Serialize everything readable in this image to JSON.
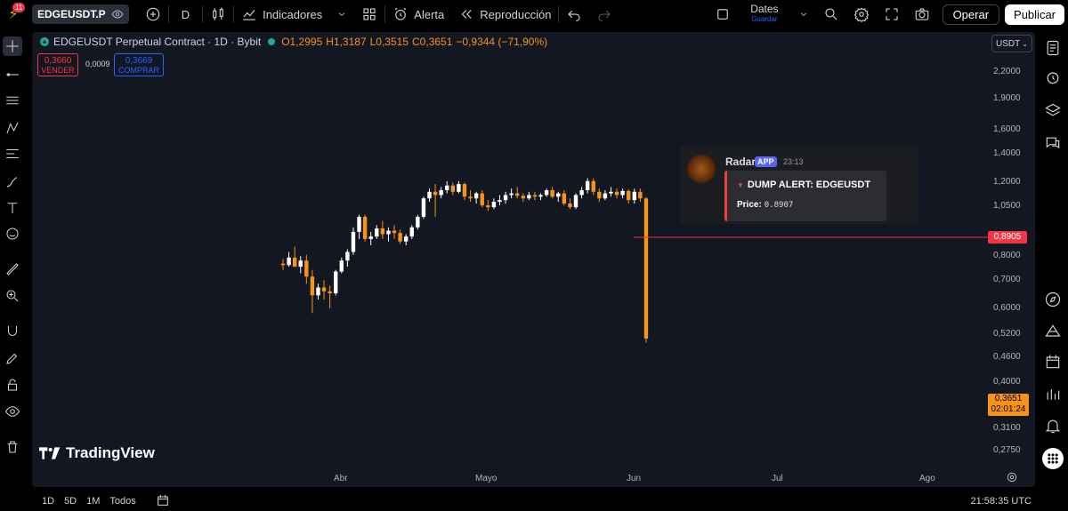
{
  "topbar": {
    "notification_count": "11",
    "symbol": "EDGEUSDT.P",
    "interval": "D",
    "indicators_label": "Indicadores",
    "alert_label": "Alerta",
    "replay_label": "Reproducción",
    "layout_name": "Dates",
    "layout_save": "Guardar",
    "trade_label": "Operar",
    "publish_label": "Publicar"
  },
  "legend": {
    "title": "EDGEUSDT Perpetual Contract · 1D · Bybit",
    "open": "O1,2995",
    "high": "H1,3187",
    "low": "L0,3515",
    "close": "C0,3651",
    "change": "−0,9344 (−71,90%)"
  },
  "trade": {
    "sell_price": "0,3660",
    "sell_label": "VENDER",
    "spread": "0,0009",
    "buy_price": "0,3669",
    "buy_label": "COMPRAR"
  },
  "currency": "USDT",
  "price_axis": [
    "2,2000",
    "1,9000",
    "1,6000",
    "1,4000",
    "1,2000",
    "1,0500",
    "0,8000",
    "0,7000",
    "0,6000",
    "0,5200",
    "0,4600",
    "0,4000",
    "0,3100",
    "0,2750"
  ],
  "alert_price": "0,8905",
  "last_price": "0,3651",
  "countdown": "02:01:24",
  "time_axis": [
    "Abr",
    "Mayo",
    "Jun",
    "Jul",
    "Ago"
  ],
  "brand": "TradingView",
  "notification": {
    "name": "Radar",
    "badge": "APP",
    "time": "23:13",
    "title": "DUMP ALERT: EDGEUSDT",
    "price_label": "Price:",
    "price_value": "0.8907"
  },
  "bottombar": {
    "ranges": [
      "1D",
      "5D",
      "1M",
      "Todos"
    ],
    "clock": "21:58:35 UTC"
  },
  "colors": {
    "up": "#ffffff",
    "down": "#f7931a",
    "alert": "#f23645",
    "background": "#131722"
  },
  "chart_data": {
    "type": "candlestick",
    "scale": "log",
    "x_ticks": [
      "Abr",
      "Mayo",
      "Jun",
      "Jul",
      "Ago"
    ],
    "ylim": [
      0.26,
      2.4
    ],
    "series": [
      {
        "candles": [
          {
            "o": 0.72,
            "h": 0.75,
            "l": 0.68,
            "c": 0.71
          },
          {
            "o": 0.71,
            "h": 0.8,
            "l": 0.7,
            "c": 0.76
          },
          {
            "o": 0.76,
            "h": 0.84,
            "l": 0.7,
            "c": 0.7
          },
          {
            "o": 0.7,
            "h": 0.77,
            "l": 0.66,
            "c": 0.74
          },
          {
            "o": 0.74,
            "h": 0.78,
            "l": 0.6,
            "c": 0.64
          },
          {
            "o": 0.64,
            "h": 0.68,
            "l": 0.46,
            "c": 0.54
          },
          {
            "o": 0.54,
            "h": 0.6,
            "l": 0.52,
            "c": 0.58
          },
          {
            "o": 0.58,
            "h": 0.62,
            "l": 0.52,
            "c": 0.56
          },
          {
            "o": 0.56,
            "h": 0.59,
            "l": 0.48,
            "c": 0.55
          },
          {
            "o": 0.55,
            "h": 0.68,
            "l": 0.54,
            "c": 0.67
          },
          {
            "o": 0.67,
            "h": 0.76,
            "l": 0.66,
            "c": 0.74
          },
          {
            "o": 0.74,
            "h": 0.82,
            "l": 0.7,
            "c": 0.8
          },
          {
            "o": 0.8,
            "h": 1.0,
            "l": 0.78,
            "c": 0.96
          },
          {
            "o": 0.96,
            "h": 1.12,
            "l": 0.9,
            "c": 1.1
          },
          {
            "o": 1.1,
            "h": 1.12,
            "l": 0.88,
            "c": 0.9
          },
          {
            "o": 0.9,
            "h": 0.96,
            "l": 0.85,
            "c": 0.92
          },
          {
            "o": 0.92,
            "h": 1.02,
            "l": 0.9,
            "c": 0.99
          },
          {
            "o": 0.99,
            "h": 1.06,
            "l": 0.9,
            "c": 0.94
          },
          {
            "o": 0.94,
            "h": 1.0,
            "l": 0.88,
            "c": 0.97
          },
          {
            "o": 0.97,
            "h": 1.02,
            "l": 0.9,
            "c": 0.95
          },
          {
            "o": 0.95,
            "h": 0.98,
            "l": 0.86,
            "c": 0.88
          },
          {
            "o": 0.88,
            "h": 0.94,
            "l": 0.85,
            "c": 0.92
          },
          {
            "o": 0.92,
            "h": 1.02,
            "l": 0.9,
            "c": 1.0
          },
          {
            "o": 1.0,
            "h": 1.12,
            "l": 0.98,
            "c": 1.1
          },
          {
            "o": 1.1,
            "h": 1.32,
            "l": 1.08,
            "c": 1.3
          },
          {
            "o": 1.3,
            "h": 1.42,
            "l": 1.26,
            "c": 1.38
          },
          {
            "o": 1.38,
            "h": 1.48,
            "l": 1.1,
            "c": 1.34
          },
          {
            "o": 1.34,
            "h": 1.44,
            "l": 1.3,
            "c": 1.4
          },
          {
            "o": 1.4,
            "h": 1.52,
            "l": 1.36,
            "c": 1.46
          },
          {
            "o": 1.46,
            "h": 1.5,
            "l": 1.34,
            "c": 1.38
          },
          {
            "o": 1.38,
            "h": 1.52,
            "l": 1.36,
            "c": 1.48
          },
          {
            "o": 1.48,
            "h": 1.5,
            "l": 1.28,
            "c": 1.32
          },
          {
            "o": 1.32,
            "h": 1.4,
            "l": 1.26,
            "c": 1.3
          },
          {
            "o": 1.3,
            "h": 1.38,
            "l": 1.24,
            "c": 1.36
          },
          {
            "o": 1.36,
            "h": 1.4,
            "l": 1.2,
            "c": 1.22
          },
          {
            "o": 1.22,
            "h": 1.28,
            "l": 1.16,
            "c": 1.2
          },
          {
            "o": 1.2,
            "h": 1.3,
            "l": 1.18,
            "c": 1.26
          },
          {
            "o": 1.26,
            "h": 1.34,
            "l": 1.22,
            "c": 1.28
          },
          {
            "o": 1.28,
            "h": 1.38,
            "l": 1.24,
            "c": 1.34
          },
          {
            "o": 1.34,
            "h": 1.42,
            "l": 1.3,
            "c": 1.36
          },
          {
            "o": 1.36,
            "h": 1.44,
            "l": 1.3,
            "c": 1.33
          },
          {
            "o": 1.33,
            "h": 1.36,
            "l": 1.26,
            "c": 1.3
          },
          {
            "o": 1.3,
            "h": 1.38,
            "l": 1.28,
            "c": 1.34
          },
          {
            "o": 1.34,
            "h": 1.38,
            "l": 1.28,
            "c": 1.32
          },
          {
            "o": 1.32,
            "h": 1.36,
            "l": 1.28,
            "c": 1.34
          },
          {
            "o": 1.34,
            "h": 1.42,
            "l": 1.32,
            "c": 1.4
          },
          {
            "o": 1.4,
            "h": 1.44,
            "l": 1.3,
            "c": 1.32
          },
          {
            "o": 1.32,
            "h": 1.38,
            "l": 1.26,
            "c": 1.36
          },
          {
            "o": 1.36,
            "h": 1.4,
            "l": 1.22,
            "c": 1.24
          },
          {
            "o": 1.24,
            "h": 1.3,
            "l": 1.18,
            "c": 1.2
          },
          {
            "o": 1.2,
            "h": 1.36,
            "l": 1.18,
            "c": 1.34
          },
          {
            "o": 1.34,
            "h": 1.44,
            "l": 1.3,
            "c": 1.4
          },
          {
            "o": 1.4,
            "h": 1.56,
            "l": 1.36,
            "c": 1.52
          },
          {
            "o": 1.52,
            "h": 1.56,
            "l": 1.34,
            "c": 1.38
          },
          {
            "o": 1.38,
            "h": 1.42,
            "l": 1.26,
            "c": 1.3
          },
          {
            "o": 1.3,
            "h": 1.4,
            "l": 1.28,
            "c": 1.36
          },
          {
            "o": 1.36,
            "h": 1.44,
            "l": 1.32,
            "c": 1.38
          },
          {
            "o": 1.38,
            "h": 1.42,
            "l": 1.3,
            "c": 1.34
          },
          {
            "o": 1.34,
            "h": 1.42,
            "l": 1.3,
            "c": 1.39
          },
          {
            "o": 1.39,
            "h": 1.41,
            "l": 1.24,
            "c": 1.28
          },
          {
            "o": 1.28,
            "h": 1.42,
            "l": 1.24,
            "c": 1.38
          },
          {
            "o": 1.38,
            "h": 1.42,
            "l": 1.26,
            "c": 1.3
          },
          {
            "o": 1.2995,
            "h": 1.3187,
            "l": 0.3515,
            "c": 0.3651
          }
        ]
      }
    ]
  }
}
